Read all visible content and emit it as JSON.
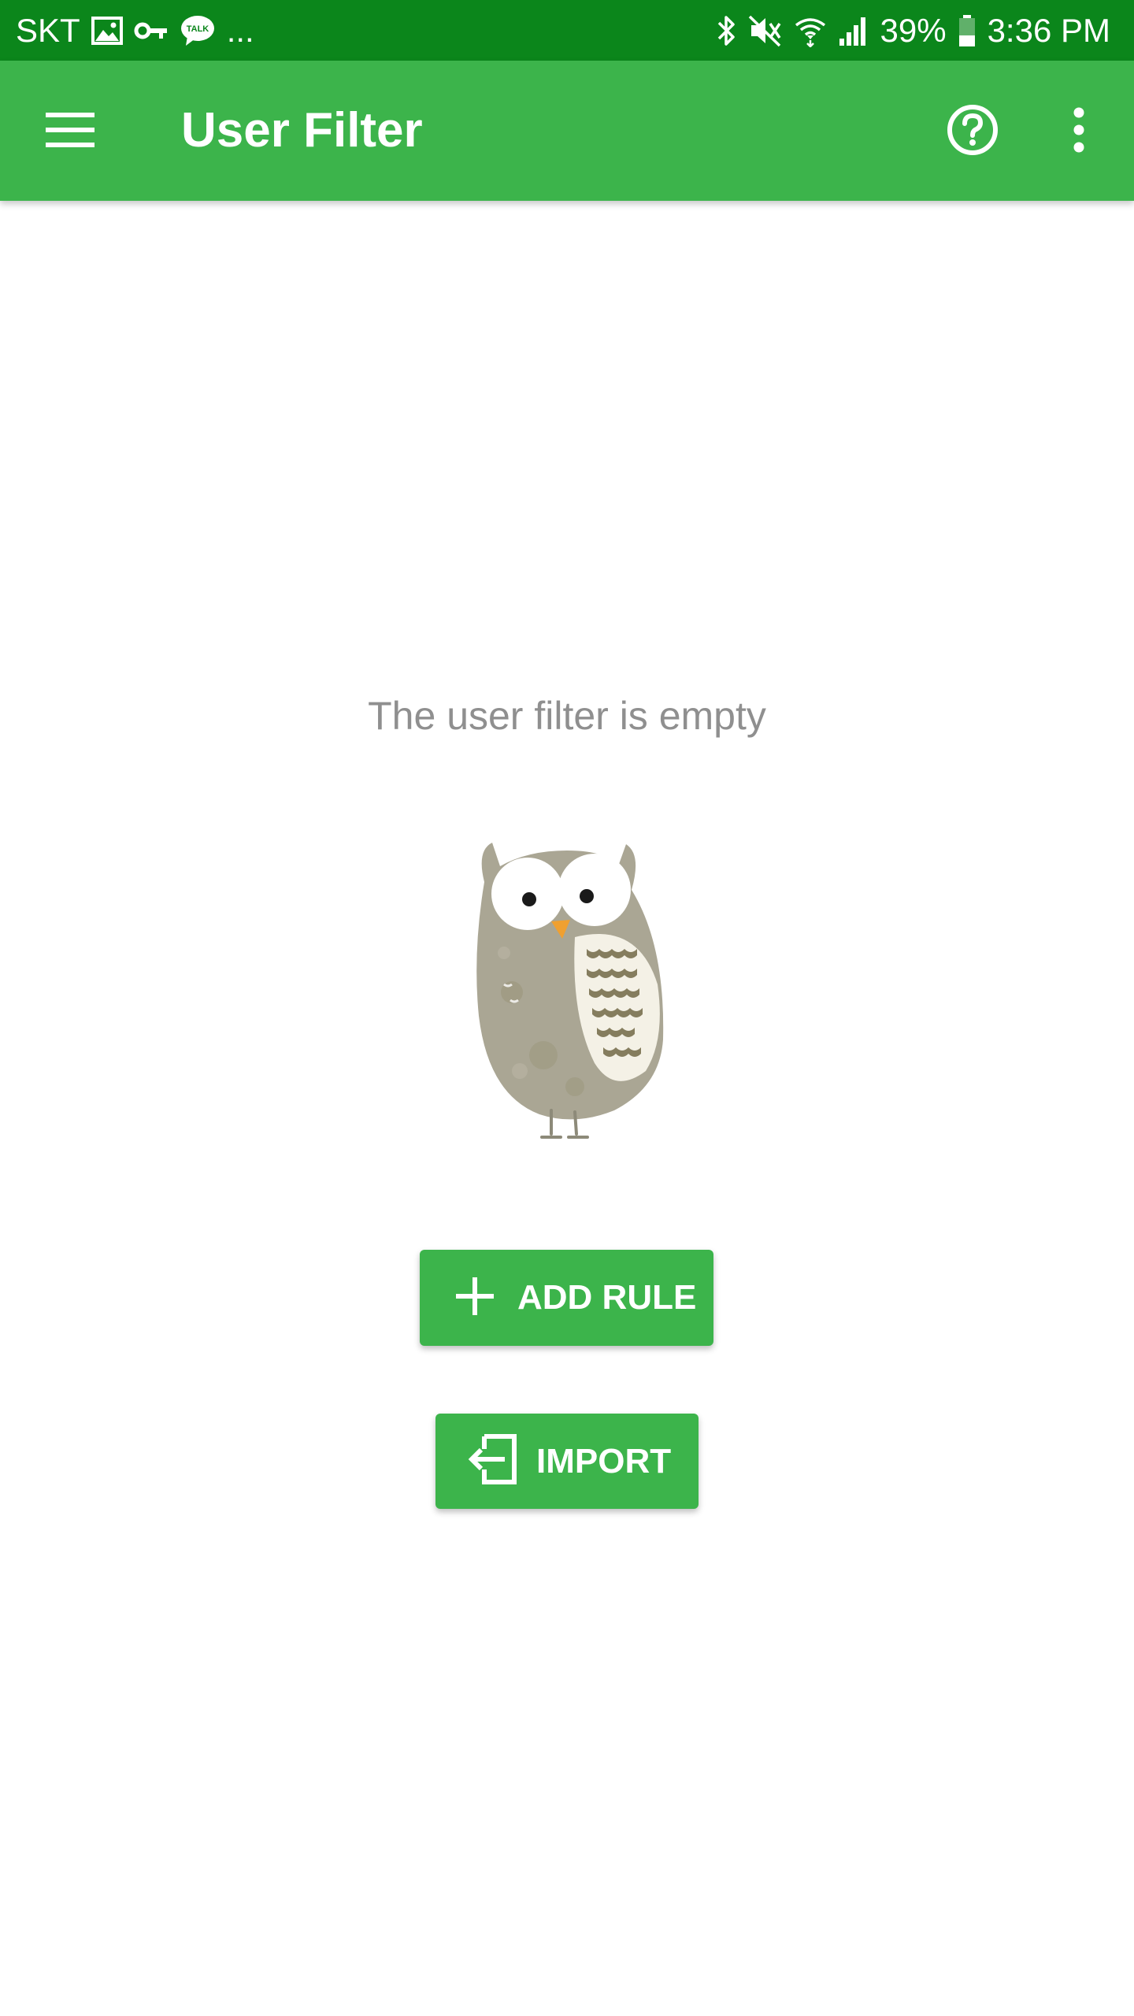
{
  "status_bar": {
    "carrier": "SKT",
    "notification_icons": [
      "image-icon",
      "key-icon",
      "talk-icon"
    ],
    "more_indicator": "...",
    "system_icons": [
      "bluetooth-icon",
      "mute-icon",
      "wifi-icon",
      "signal-icon"
    ],
    "battery_percent": "39%",
    "battery_level": 0.39,
    "time": "3:36 PM",
    "talk_badge_text": "TALK"
  },
  "app_bar": {
    "title": "User Filter",
    "menu_icon": "hamburger-menu-icon",
    "help_icon": "help-circle-icon",
    "overflow_icon": "more-vert-icon",
    "background_color": "#3cb44b"
  },
  "main": {
    "empty_message": "The user filter is empty",
    "illustration": "owl-illustration",
    "add_rule_button": {
      "label": "ADD RULE",
      "icon": "plus-icon"
    },
    "import_button": {
      "label": "IMPORT",
      "icon": "import-icon"
    }
  },
  "colors": {
    "status_bar": "#0b861b",
    "accent": "#3cb44b",
    "empty_text": "#8f8f8f"
  }
}
